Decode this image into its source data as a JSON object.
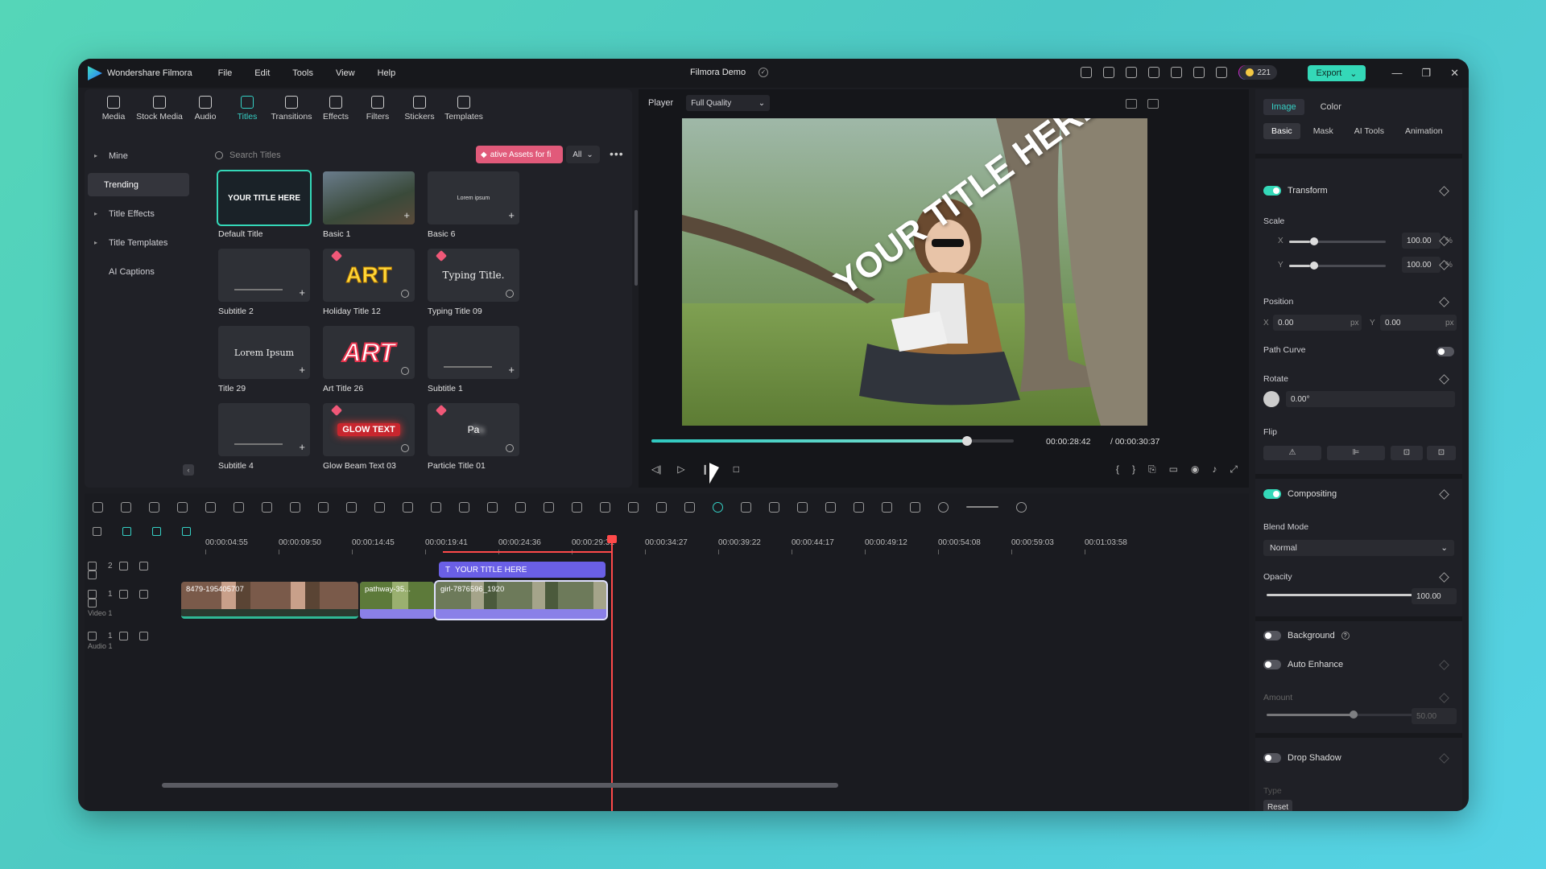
{
  "app": {
    "name": "Wondershare Filmora",
    "project": "Filmora Demo",
    "credits": "221",
    "export_label": "Export"
  },
  "menu": [
    "File",
    "Edit",
    "Tools",
    "View",
    "Help"
  ],
  "library": {
    "tabs": [
      {
        "label": "Media",
        "icon": "media-icon"
      },
      {
        "label": "Stock Media",
        "icon": "stock-media-icon"
      },
      {
        "label": "Audio",
        "icon": "audio-icon"
      },
      {
        "label": "Titles",
        "icon": "titles-icon"
      },
      {
        "label": "Transitions",
        "icon": "transitions-icon"
      },
      {
        "label": "Effects",
        "icon": "effects-icon"
      },
      {
        "label": "Filters",
        "icon": "filters-icon"
      },
      {
        "label": "Stickers",
        "icon": "stickers-icon"
      },
      {
        "label": "Templates",
        "icon": "templates-icon"
      }
    ],
    "sidebar": [
      "Mine",
      "Trending",
      "Title Effects",
      "Title Templates",
      "AI Captions"
    ],
    "search_placeholder": "Search Titles",
    "promo": "ative Assets for fi",
    "filter": "All",
    "cards": [
      {
        "label": "Default Title",
        "thumb_text": "YOUR TITLE HERE"
      },
      {
        "label": "Basic 1",
        "thumb_text": ""
      },
      {
        "label": "Basic 6",
        "thumb_text": "Lorem ipsum"
      },
      {
        "label": "Subtitle 2",
        "thumb_text": ""
      },
      {
        "label": "Holiday Title 12",
        "thumb_text": "ART"
      },
      {
        "label": "Typing Title 09",
        "thumb_text": "Typing Title."
      },
      {
        "label": "Title 29",
        "thumb_text": "Lorem Ipsum"
      },
      {
        "label": "Art Title 26",
        "thumb_text": "ART"
      },
      {
        "label": "Subtitle 1",
        "thumb_text": ""
      },
      {
        "label": "Subtitle 4",
        "thumb_text": ""
      },
      {
        "label": "Glow Beam Text 03",
        "thumb_text": "GLOW TEXT"
      },
      {
        "label": "Particle Title 01",
        "thumb_text": "Pa"
      }
    ]
  },
  "player": {
    "label": "Player",
    "quality": "Full Quality",
    "overlay_text": "YOUR TITLE HERE",
    "current_time": "00:00:28:42",
    "total_time": "/ 00:00:30:37",
    "progress": 0.87
  },
  "timeline": {
    "ticks": [
      "00:00:04:55",
      "00:00:09:50",
      "00:00:14:45",
      "00:00:19:41",
      "00:00:24:36",
      "00:00:29:31",
      "00:00:34:27",
      "00:00:39:22",
      "00:00:44:17",
      "00:00:49:12",
      "00:00:54:08",
      "00:00:59:03",
      "00:01:03:58"
    ],
    "tracks": [
      {
        "num": "2",
        "name": ""
      },
      {
        "num": "1",
        "name": "Video 1"
      },
      {
        "num": "1",
        "name": "Audio 1"
      }
    ],
    "title_clip": "YOUR TITLE HERE",
    "video_clips": [
      "8479-195405707",
      "pathway-35...",
      "girl-7876596_1920"
    ]
  },
  "props": {
    "tabs": [
      "Image",
      "Color"
    ],
    "subtabs": [
      "Basic",
      "Mask",
      "AI Tools",
      "Animation"
    ],
    "transform": "Transform",
    "scale": "Scale",
    "scale_x": "100.00",
    "scale_y": "100.00",
    "pct": "%",
    "x_label": "X",
    "y_label": "Y",
    "position": "Position",
    "pos_x": "0.00",
    "pos_y": "0.00",
    "px": "px",
    "path_curve": "Path Curve",
    "rotate": "Rotate",
    "rotate_val": "0.00°",
    "flip": "Flip",
    "compositing": "Compositing",
    "blend_mode": "Blend Mode",
    "blend_val": "Normal",
    "opacity": "Opacity",
    "opacity_val": "100.00",
    "opacity_level": 1.0,
    "background": "Background",
    "auto_enhance": "Auto Enhance",
    "amount": "Amount",
    "amount_val": "50.00",
    "amount_level": 0.5,
    "drop_shadow": "Drop Shadow",
    "type": "Type",
    "reset": "Reset"
  }
}
